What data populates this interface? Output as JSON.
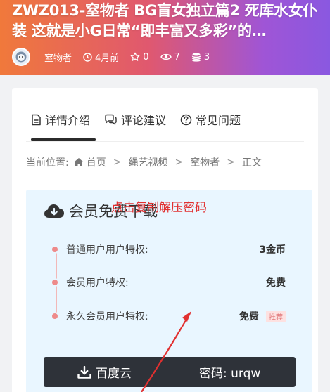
{
  "post": {
    "title": "ZWZ013-窒物者 BG盲女独立篇2 死库水女仆装 这就是小G日常“即丰富又多彩”的…",
    "author": "窒物者",
    "time": "4月前",
    "stars": "0",
    "views": "7",
    "coins": "3"
  },
  "tabs": [
    {
      "label": "详情介绍",
      "icon": "document-icon"
    },
    {
      "label": "评论建议",
      "icon": "comment-icon"
    },
    {
      "label": "常见问题",
      "icon": "question-icon"
    }
  ],
  "breadcrumb": {
    "prefix": "当前位置:",
    "home": "首页",
    "items": [
      "绳艺视频",
      "窒物者",
      "正文"
    ]
  },
  "download": {
    "heading": "会员免费下载",
    "rows": [
      {
        "label": "普通用户用户特权:",
        "value": "3金币",
        "badge": ""
      },
      {
        "label": "会员用户特权:",
        "value": "免费",
        "badge": ""
      },
      {
        "label": "永久会员用户特权:",
        "value": "免费",
        "badge": "推荐"
      }
    ],
    "annotation": "点击复制解压密码",
    "button_label": "百度云",
    "password": "密码: urqw"
  },
  "colors": {
    "gradient_start": "#f0793b",
    "gradient_end": "#8a58e0",
    "annotation": "#e13030",
    "panel": "#e9f6ff",
    "button": "#2e3239"
  }
}
